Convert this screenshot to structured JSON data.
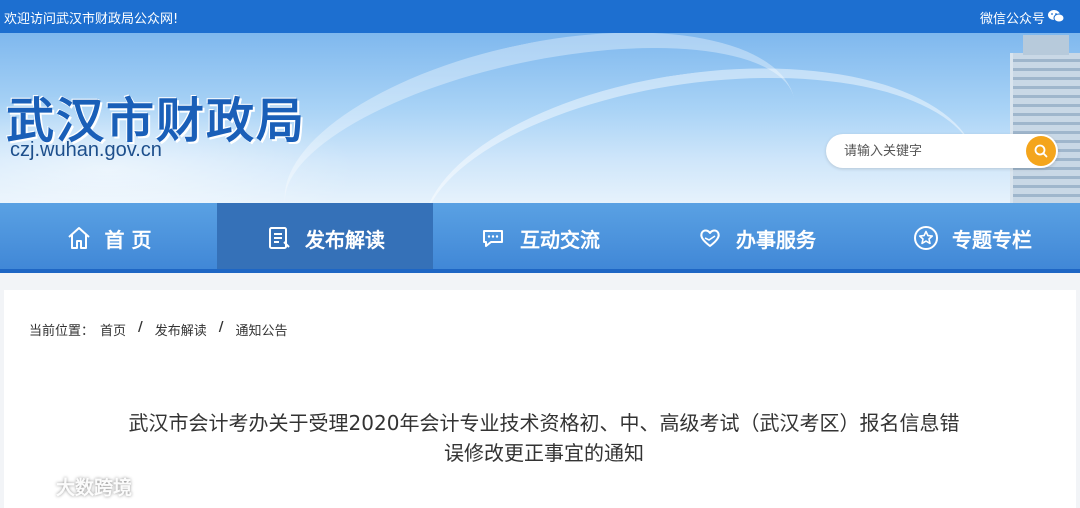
{
  "topbar": {
    "welcome": "欢迎访问武汉市财政局公众网!",
    "wechat_label": "微信公众号",
    "wechat_icon": "wechat-icon"
  },
  "header": {
    "title": "武汉市财政局",
    "domain": "czj.wuhan.gov.cn"
  },
  "search": {
    "placeholder": "请输入关键字",
    "button_icon": "search-icon"
  },
  "nav": {
    "items": [
      {
        "label": "首 页",
        "icon": "home-icon",
        "active": false
      },
      {
        "label": "发布解读",
        "icon": "document-icon",
        "active": true
      },
      {
        "label": "互动交流",
        "icon": "chat-icon",
        "active": false
      },
      {
        "label": "办事服务",
        "icon": "heart-hand-icon",
        "active": false
      },
      {
        "label": "专题专栏",
        "icon": "star-icon",
        "active": false
      }
    ]
  },
  "breadcrumb": {
    "prefix": "当前位置：",
    "items": [
      "首页",
      "发布解读",
      "通知公告"
    ]
  },
  "article": {
    "title_line1": "武汉市会计考办关于受理2020年会计专业技术资格初、中、高级考试（武汉考区）报名信息错",
    "title_line2": "误修改更正事宜的通知"
  },
  "watermark": {
    "text": "大数跨境"
  },
  "colors": {
    "topbar": "#1d6fd0",
    "nav": "#4a92dd",
    "nav_active": "#3571b8",
    "search_button": "#f4a51c",
    "title": "#1a5fb8"
  }
}
